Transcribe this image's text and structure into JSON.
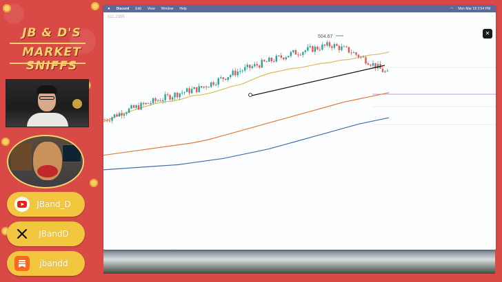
{
  "brand": {
    "line1": "JB & D'S",
    "line2": "MARKET SNIFFS"
  },
  "socials": [
    {
      "platform": "youtube",
      "icon": "youtube-icon",
      "handle": "JBand_D",
      "color": "#e62117"
    },
    {
      "platform": "x",
      "icon": "x-icon",
      "handle": "JBandD",
      "color": "#000000"
    },
    {
      "platform": "substack",
      "icon": "substack-icon",
      "handle": "jbandd",
      "color": "#ff6719"
    }
  ],
  "menubar": {
    "app": "Discord",
    "items": [
      "Edit",
      "View",
      "Window",
      "Help"
    ],
    "clock": "Mon Mar 18  2:54 PM"
  },
  "chart": {
    "header_value": "511.2355",
    "peak_label": "504.67",
    "colors": {
      "up": "#26a69a",
      "down": "#ef5350",
      "ma_short": "#e0b85a",
      "ma_mid": "#e07a3c",
      "ma_long": "#3d6fb0",
      "trendline": "#111111",
      "level": "#b57fd0"
    }
  },
  "chart_data": {
    "type": "line",
    "title": "",
    "xlabel": "",
    "ylabel": "",
    "series": [
      {
        "name": "",
        "values": [
          430,
          434,
          438,
          441,
          444,
          447,
          449,
          450,
          452,
          455,
          456,
          458,
          461,
          464,
          466,
          470,
          474,
          477,
          479,
          481,
          482,
          484,
          486,
          487,
          489,
          490,
          492,
          494,
          495,
          497
        ]
      },
      {
        "name": "",
        "values": [
          398,
          400,
          402,
          404,
          406,
          408,
          410,
          413,
          417,
          421,
          425,
          429,
          433,
          437,
          441,
          445,
          449,
          452,
          455,
          458
        ]
      },
      {
        "name": "",
        "values": [
          384,
          385,
          386,
          387,
          388,
          389,
          391,
          393,
          395,
          398,
          401,
          404,
          408,
          412,
          416,
          420,
          424,
          428,
          431,
          434
        ]
      }
    ]
  }
}
